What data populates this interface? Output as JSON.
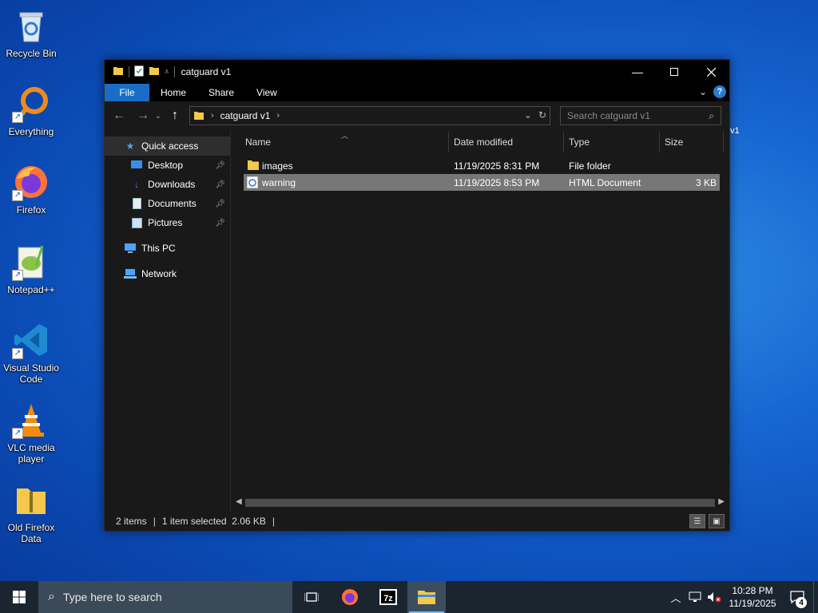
{
  "desktop": {
    "icons": [
      {
        "label": "Recycle Bin"
      },
      {
        "label": "Everything"
      },
      {
        "label": "Firefox"
      },
      {
        "label": "Notepad++"
      },
      {
        "label": "Visual Studio Code"
      },
      {
        "label": "VLC media player"
      },
      {
        "label": "Old Firefox Data"
      }
    ],
    "stray_text": "v1"
  },
  "window": {
    "title": "catguard v1",
    "ribbon_tabs": [
      "File",
      "Home",
      "Share",
      "View"
    ],
    "address": {
      "crumb": "catguard v1"
    },
    "search": {
      "placeholder": "Search catguard v1"
    },
    "sidebar": [
      {
        "label": "Quick access"
      },
      {
        "label": "Desktop"
      },
      {
        "label": "Downloads"
      },
      {
        "label": "Documents"
      },
      {
        "label": "Pictures"
      },
      {
        "label": "This PC"
      },
      {
        "label": "Network"
      }
    ],
    "columns": [
      "Name",
      "Date modified",
      "Type",
      "Size"
    ],
    "files": [
      {
        "name": "images",
        "date": "11/19/2025 8:31 PM",
        "type": "File folder",
        "size": ""
      },
      {
        "name": "warning",
        "date": "11/19/2025 8:53 PM",
        "type": "HTML Document",
        "size": "3 KB"
      }
    ],
    "status": {
      "count": "2 items",
      "selected": "1 item selected  2.06 KB"
    }
  },
  "taskbar": {
    "search_placeholder": "Type here to search",
    "time": "10:28 PM",
    "date": "11/19/2025",
    "notification_count": "4"
  }
}
